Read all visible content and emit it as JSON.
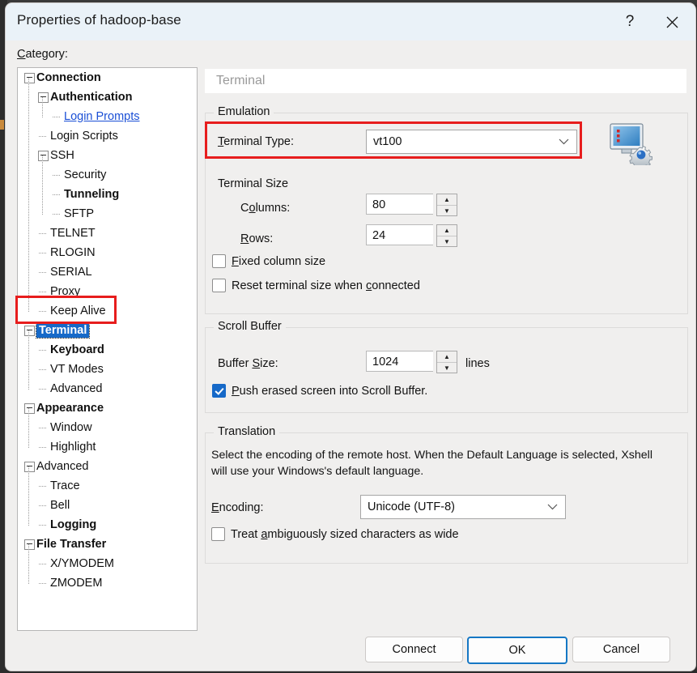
{
  "window": {
    "title": "Properties of hadoop-base",
    "help_button": "?",
    "close_button": "×"
  },
  "category": {
    "label": "Category:",
    "mnemonic": "C"
  },
  "tree": {
    "items": [
      {
        "label": "Connection",
        "depth": 0,
        "bold": true,
        "expander": true,
        "selected": false,
        "link": false
      },
      {
        "label": "Authentication",
        "depth": 1,
        "bold": true,
        "expander": true,
        "selected": false,
        "link": false
      },
      {
        "label": "Login Prompts",
        "depth": 2,
        "bold": false,
        "expander": false,
        "selected": false,
        "link": true
      },
      {
        "label": "Login Scripts",
        "depth": 1,
        "bold": false,
        "expander": false,
        "selected": false,
        "link": false
      },
      {
        "label": "SSH",
        "depth": 1,
        "bold": false,
        "expander": true,
        "selected": false,
        "link": false
      },
      {
        "label": "Security",
        "depth": 2,
        "bold": false,
        "expander": false,
        "selected": false,
        "link": false
      },
      {
        "label": "Tunneling",
        "depth": 2,
        "bold": true,
        "expander": false,
        "selected": false,
        "link": false
      },
      {
        "label": "SFTP",
        "depth": 2,
        "bold": false,
        "expander": false,
        "selected": false,
        "link": false
      },
      {
        "label": "TELNET",
        "depth": 1,
        "bold": false,
        "expander": false,
        "selected": false,
        "link": false
      },
      {
        "label": "RLOGIN",
        "depth": 1,
        "bold": false,
        "expander": false,
        "selected": false,
        "link": false
      },
      {
        "label": "SERIAL",
        "depth": 1,
        "bold": false,
        "expander": false,
        "selected": false,
        "link": false
      },
      {
        "label": "Proxy",
        "depth": 1,
        "bold": false,
        "expander": false,
        "selected": false,
        "link": false
      },
      {
        "label": "Keep Alive",
        "depth": 1,
        "bold": false,
        "expander": false,
        "selected": false,
        "link": false
      },
      {
        "label": "Terminal",
        "depth": 0,
        "bold": true,
        "expander": true,
        "selected": true,
        "link": false
      },
      {
        "label": "Keyboard",
        "depth": 1,
        "bold": true,
        "expander": false,
        "selected": false,
        "link": false
      },
      {
        "label": "VT Modes",
        "depth": 1,
        "bold": false,
        "expander": false,
        "selected": false,
        "link": false
      },
      {
        "label": "Advanced",
        "depth": 1,
        "bold": false,
        "expander": false,
        "selected": false,
        "link": false
      },
      {
        "label": "Appearance",
        "depth": 0,
        "bold": true,
        "expander": true,
        "selected": false,
        "link": false
      },
      {
        "label": "Window",
        "depth": 1,
        "bold": false,
        "expander": false,
        "selected": false,
        "link": false
      },
      {
        "label": "Highlight",
        "depth": 1,
        "bold": false,
        "expander": false,
        "selected": false,
        "link": false
      },
      {
        "label": "Advanced",
        "depth": 0,
        "bold": false,
        "expander": true,
        "selected": false,
        "link": false
      },
      {
        "label": "Trace",
        "depth": 1,
        "bold": false,
        "expander": false,
        "selected": false,
        "link": false
      },
      {
        "label": "Bell",
        "depth": 1,
        "bold": false,
        "expander": false,
        "selected": false,
        "link": false
      },
      {
        "label": "Logging",
        "depth": 1,
        "bold": true,
        "expander": false,
        "selected": false,
        "link": false
      },
      {
        "label": "File Transfer",
        "depth": 0,
        "bold": true,
        "expander": true,
        "selected": false,
        "link": false
      },
      {
        "label": "X/YMODEM",
        "depth": 1,
        "bold": false,
        "expander": false,
        "selected": false,
        "link": false
      },
      {
        "label": "ZMODEM",
        "depth": 1,
        "bold": false,
        "expander": false,
        "selected": false,
        "link": false
      }
    ]
  },
  "pane": {
    "header": "Terminal"
  },
  "emulation": {
    "group_label": "Emulation",
    "terminal_type_label": "Terminal Type:",
    "terminal_type_value": "vt100",
    "terminal_size_label": "Terminal Size",
    "columns_label": "Columns:",
    "columns_value": "80",
    "rows_label": "Rows:",
    "rows_value": "24",
    "fixed_column_label": "Fixed column size",
    "fixed_column_checked": false,
    "reset_size_label": "Reset terminal size when connected",
    "reset_size_checked": false
  },
  "scroll_buffer": {
    "group_label": "Scroll Buffer",
    "buffer_size_label": "Buffer Size:",
    "buffer_size_value": "1024",
    "units": "lines",
    "push_erased_label": "Push erased screen into Scroll Buffer.",
    "push_erased_checked": true
  },
  "translation": {
    "group_label": "Translation",
    "description": "Select the encoding of the remote host. When the Default Language is selected, Xshell will use your Windows's default language.",
    "encoding_label": "Encoding:",
    "encoding_value": "Unicode (UTF-8)",
    "ambiguous_label": "Treat ambiguously sized characters as wide",
    "ambiguous_checked": false
  },
  "footer": {
    "connect": "Connect",
    "ok": "OK",
    "cancel": "Cancel"
  },
  "annotations": {
    "color": "#e71d1d",
    "boxes": [
      "terminal-type-row",
      "terminal-tree-item"
    ]
  },
  "icons": {
    "terminal_settings": "monitor-gear-icon",
    "dropdown": "chevron-down-icon",
    "spinner_up": "triangle-up-icon",
    "spinner_down": "triangle-down-icon"
  }
}
